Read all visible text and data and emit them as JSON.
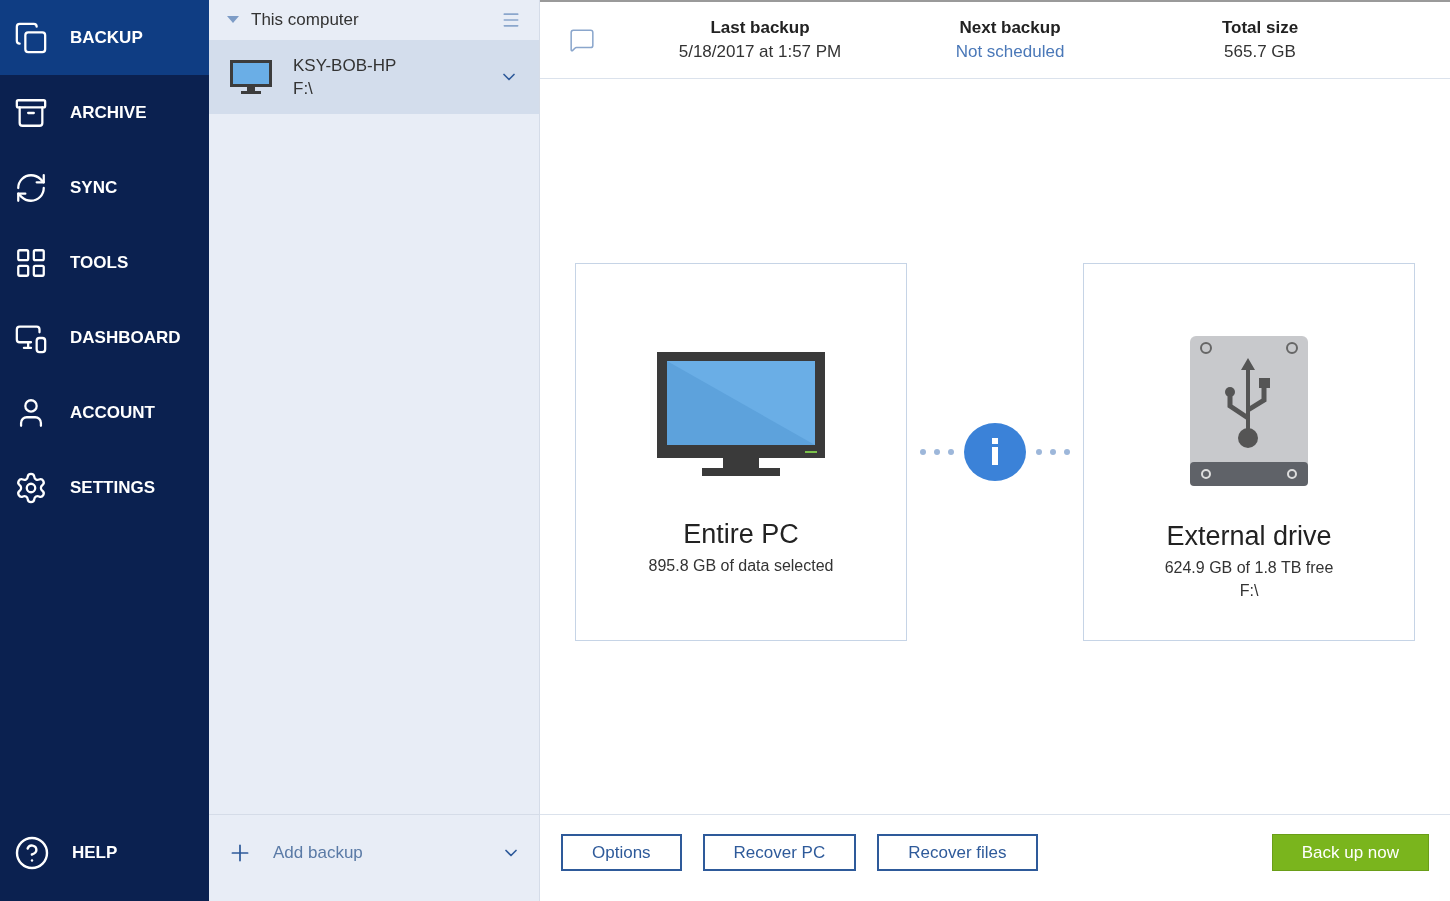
{
  "nav": [
    {
      "label": "BACKUP",
      "selected": true
    },
    {
      "label": "ARCHIVE",
      "selected": false
    },
    {
      "label": "SYNC",
      "selected": false
    },
    {
      "label": "TOOLS",
      "selected": false
    },
    {
      "label": "DASHBOARD",
      "selected": false
    },
    {
      "label": "ACCOUNT",
      "selected": false
    },
    {
      "label": "SETTINGS",
      "selected": false
    }
  ],
  "help": {
    "label": "HELP"
  },
  "backup_list": {
    "group": "This computer",
    "items": [
      {
        "name": "KSY-BOB-HP",
        "path": "F:\\",
        "selected": true
      }
    ],
    "add_label": "Add backup"
  },
  "summary": [
    {
      "label": "Last backup",
      "value": "5/18/2017 at 1:57 PM",
      "kind": "text"
    },
    {
      "label": "Next backup",
      "value": "Not scheduled",
      "kind": "link"
    },
    {
      "label": "Total size",
      "value": "565.7 GB",
      "kind": "text"
    }
  ],
  "source": {
    "title": "Entire PC",
    "details": [
      "895.8 GB of data selected"
    ]
  },
  "destination": {
    "title": "External drive",
    "details": [
      "624.9 GB of 1.8 TB free",
      "F:\\"
    ]
  },
  "buttons": [
    {
      "label": "Options",
      "kind": "outline"
    },
    {
      "label": "Recover PC",
      "kind": "outline"
    },
    {
      "label": "Recover files",
      "kind": "outline"
    },
    {
      "label": "Back up now",
      "kind": "primary"
    }
  ]
}
